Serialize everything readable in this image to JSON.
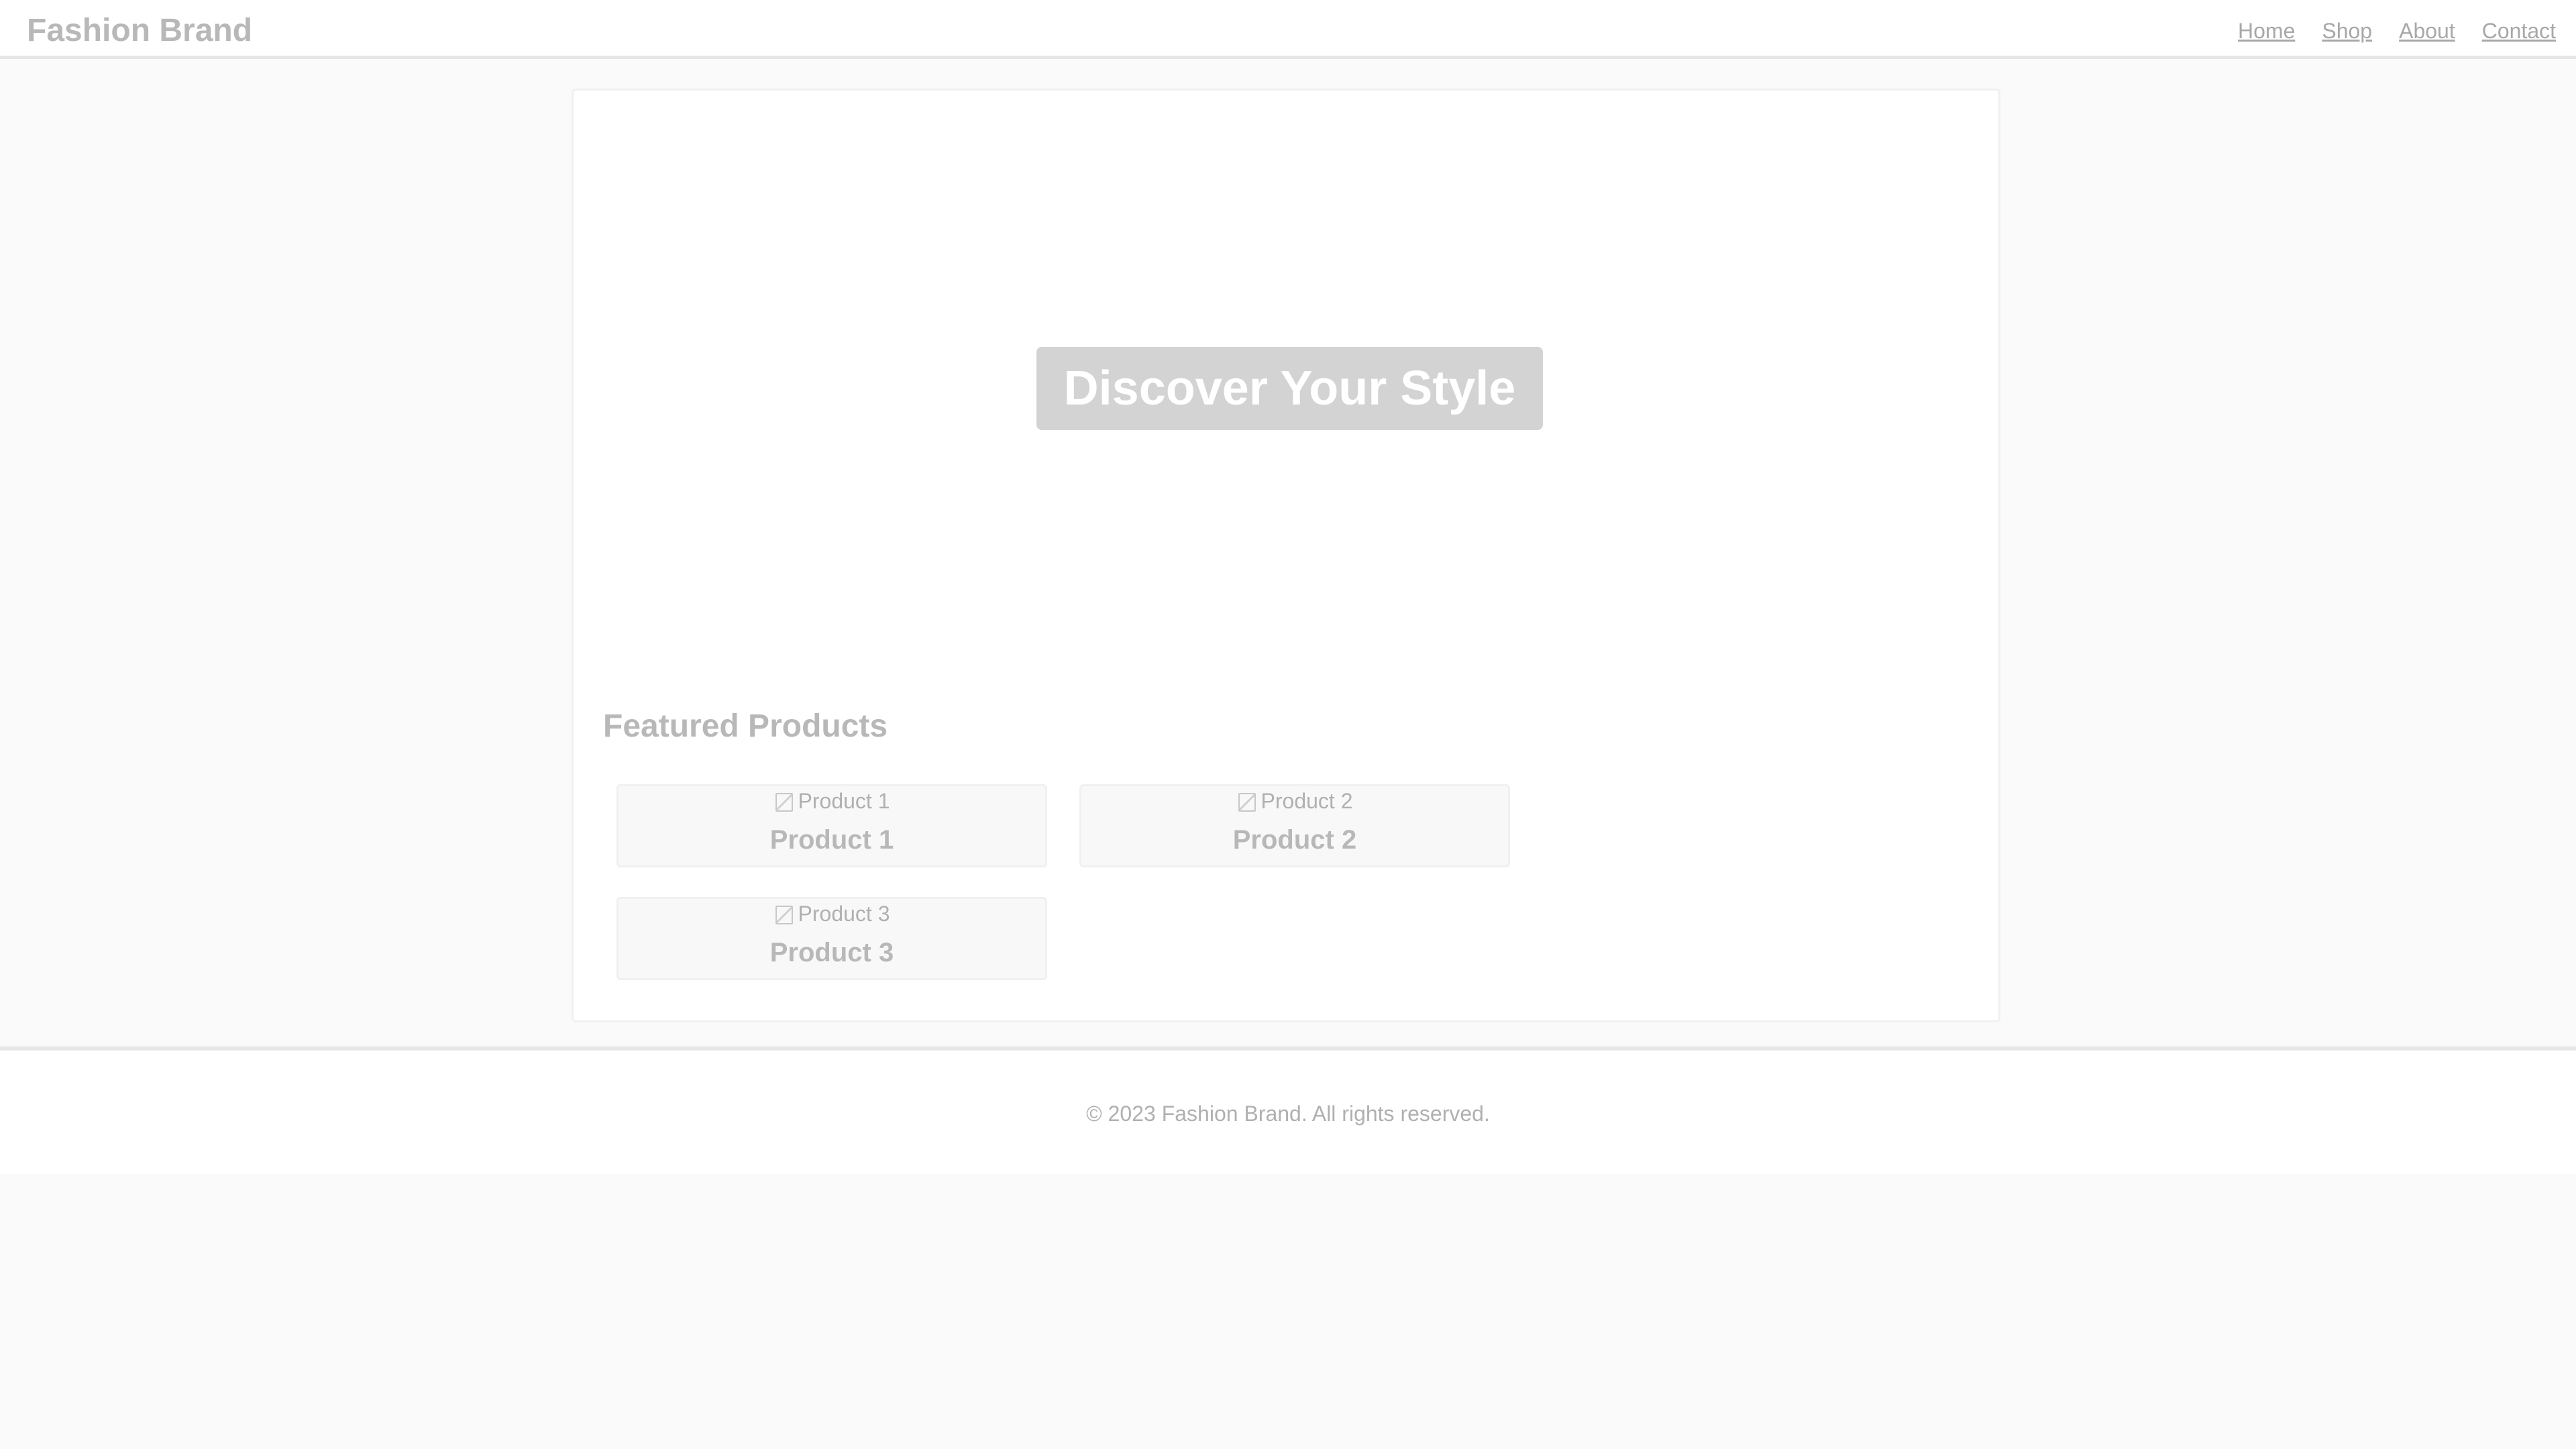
{
  "header": {
    "brand": "Fashion Brand",
    "nav": [
      "Home",
      "Shop",
      "About",
      "Contact"
    ]
  },
  "hero": {
    "title": "Discover Your Style"
  },
  "featured": {
    "title": "Featured Products",
    "products": [
      {
        "image_alt": "Product 1",
        "name": "Product 1"
      },
      {
        "image_alt": "Product 2",
        "name": "Product 2"
      },
      {
        "image_alt": "Product 3",
        "name": "Product 3"
      }
    ]
  },
  "footer": {
    "text": "© 2023 Fashion Brand. All rights reserved."
  },
  "colors": {
    "background": "#fafafa",
    "hero_badge": "#d3d3d3",
    "text_muted": "#b8b8b8"
  }
}
